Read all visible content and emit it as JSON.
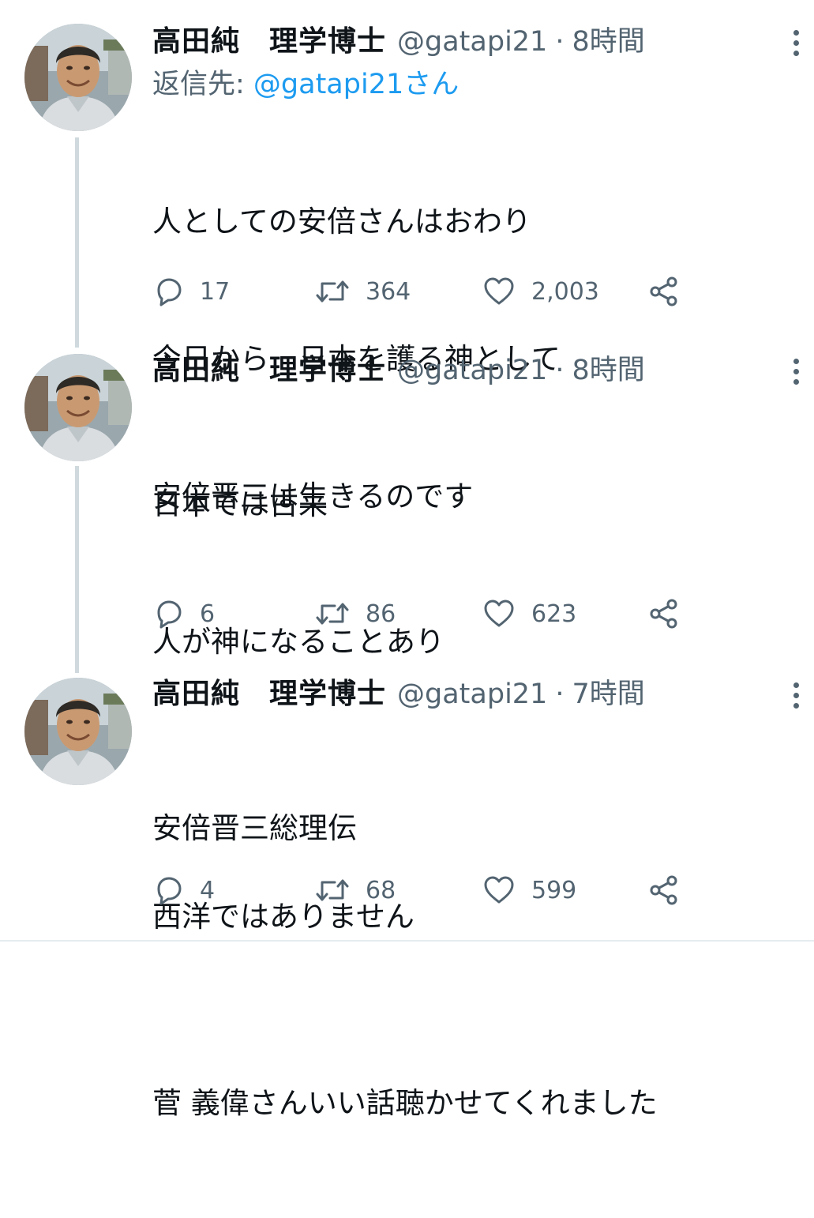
{
  "colors": {
    "text": "#0f1419",
    "secondary": "#536471",
    "link": "#1d9bf0",
    "thread_line": "#cfd9de"
  },
  "tweets": [
    {
      "display_name": "高田純　理学博士",
      "handle": "@gatapi21",
      "separator": "·",
      "time": "8時間",
      "reply_label": "返信先: ",
      "reply_handle": "@gatapi21さん",
      "lines": [
        "人としての安倍さんはおわり",
        "今日から　日本を護る神として",
        "安倍晋三は生きるのです"
      ],
      "replies": "17",
      "retweets": "364",
      "likes": "2,003"
    },
    {
      "display_name": "高田純　理学博士",
      "handle": "@gatapi21",
      "separator": "·",
      "time": "8時間",
      "lines": [
        "日本では古来",
        "人が神になることあり",
        "",
        "西洋ではありません"
      ],
      "replies": "6",
      "retweets": "86",
      "likes": "623"
    },
    {
      "display_name": "高田純　理学博士",
      "handle": "@gatapi21",
      "separator": "·",
      "time": "7時間",
      "lines": [
        "安倍晋三総理伝",
        "",
        "菅 義偉さんいい話聴かせてくれました"
      ],
      "replies": "4",
      "retweets": "68",
      "likes": "599"
    }
  ],
  "icons": {
    "reply": "reply-bubble-icon",
    "retweet": "retweet-arrows-icon",
    "like": "heart-icon",
    "share": "share-icon",
    "more": "more-vertical-icon"
  }
}
